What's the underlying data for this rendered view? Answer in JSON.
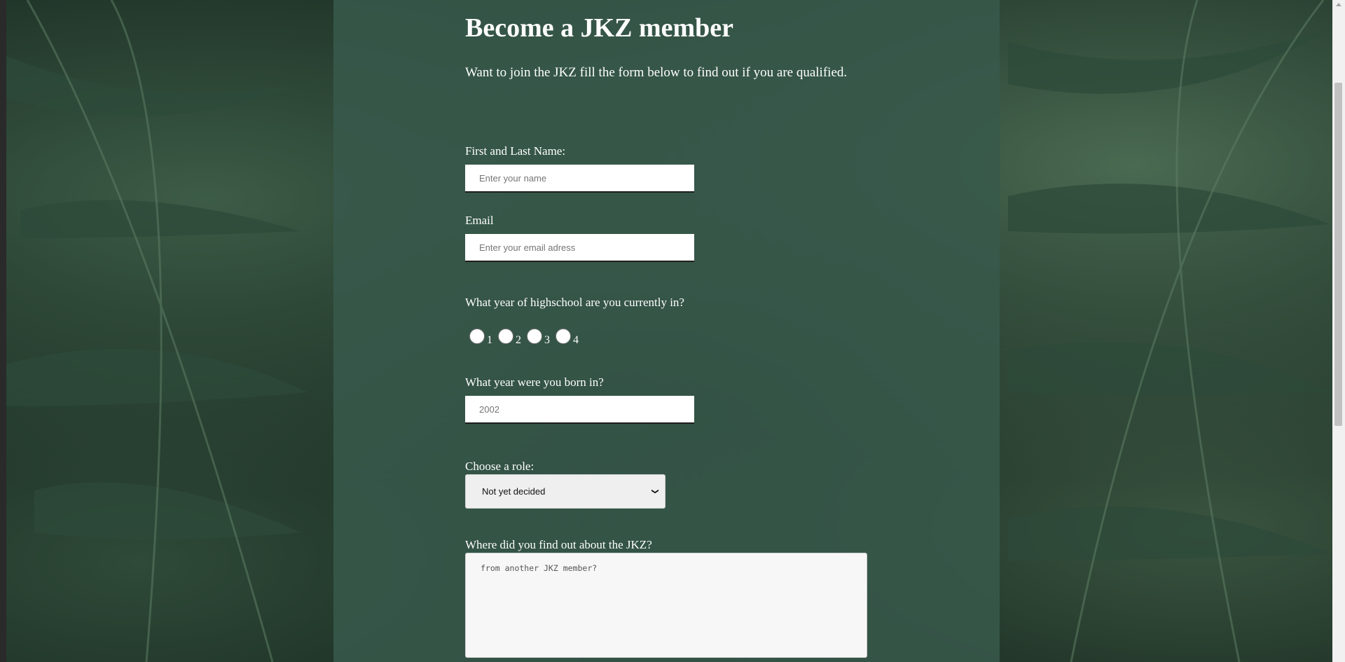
{
  "form": {
    "title": "Become a JKZ member",
    "subtitle": "Want to join the JKZ fill the form below to find out if you are qualified.",
    "name": {
      "label": "First and Last Name:",
      "placeholder": "Enter your name"
    },
    "email": {
      "label": "Email",
      "placeholder": "Enter your email adress"
    },
    "highschool_year": {
      "label": "What year of highschool are you currently in?",
      "options": [
        "1",
        "2",
        "3",
        "4"
      ]
    },
    "birth_year": {
      "label": "What year were you born in?",
      "placeholder": "2002"
    },
    "role": {
      "label": "Choose a role:",
      "selected": "Not yet decided"
    },
    "source": {
      "label": "Where did you find out about the JKZ?",
      "placeholder": "from another JKZ member?"
    }
  },
  "colors": {
    "panel": "#385a4c",
    "text": "#ffffff",
    "input_bg": "#ffffff"
  }
}
